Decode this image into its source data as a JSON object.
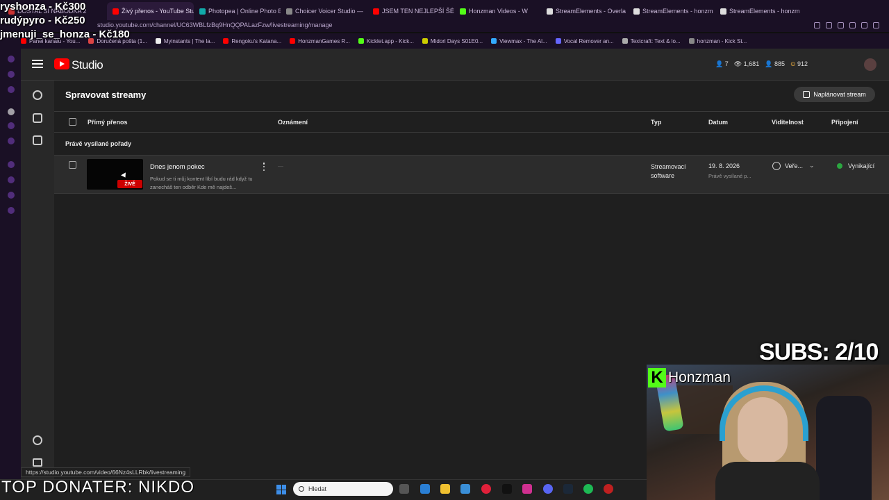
{
  "browser": {
    "tabs": [
      {
        "label": "DOSTAL SI NÁBODKA 2",
        "color": "#c33"
      },
      {
        "label": "Živý přenos - YouTube Stu",
        "color": "#f00",
        "active": true
      },
      {
        "label": "Photopea | Online Photo E",
        "color": "#1aa"
      },
      {
        "label": "Choicer Voicer Studio —",
        "color": "#888"
      },
      {
        "label": "JSEM TEN NEJLEPŠÍ ŠÉF",
        "color": "#f00"
      },
      {
        "label": "Honzman Videos - W",
        "color": "#53fc18"
      },
      {
        "label": "StreamElements - Overla",
        "color": "#ddd"
      },
      {
        "label": "StreamElements - honzm",
        "color": "#ddd"
      },
      {
        "label": "StreamElements - honzm",
        "color": "#ddd"
      }
    ],
    "url": "studio.youtube.com/channel/UC63WBLfzBq9HnQQPALazFzw/livestreaming/manage",
    "bookmarks": [
      {
        "label": "Panel kanálu - You...",
        "color": "#f00"
      },
      {
        "label": "Doručená pošta (1...",
        "color": "#d44"
      },
      {
        "label": "Myinstants | The la...",
        "color": "#eee"
      },
      {
        "label": "Rengoku's Katana...",
        "color": "#f00"
      },
      {
        "label": "HonzmanGames R...",
        "color": "#f00"
      },
      {
        "label": "Kicklet.app - Kick...",
        "color": "#53fc18"
      },
      {
        "label": "Midori Days S01E0...",
        "color": "#cc0"
      },
      {
        "label": "Viewmax - The Al...",
        "color": "#3af"
      },
      {
        "label": "Vocal Remover an...",
        "color": "#66f"
      },
      {
        "label": "Textcraft: Text & lo...",
        "color": "#aaa"
      },
      {
        "label": "honzman - Kick St...",
        "color": "#888"
      }
    ]
  },
  "studio": {
    "logo_text": "Studio",
    "header_stats": {
      "a": "7",
      "b": "1,681",
      "c": "885",
      "d": "912"
    },
    "page_title": "Spravovat streamy",
    "schedule_button": "Naplánovat stream",
    "columns": {
      "live": "Přímý přenos",
      "announcement": "Oznámení",
      "type": "Typ",
      "date": "Datum",
      "visibility": "Viditelnost",
      "connection": "Připojení"
    },
    "section_label": "Právě vysílané pořady",
    "row": {
      "title": "Dnes jenom pokec",
      "description": "Pokud se ti můj kontent líbí budu rád když tu zanecháš ten odběr Kde mě najdeš...",
      "live_badge": "ŽIVĚ",
      "announcement": "—",
      "type": "Streamovací software",
      "date": "19. 8. 2026",
      "date_sub": "Právě vysílané p...",
      "visibility": "Veře...",
      "connection": "Vynikající"
    },
    "status_url": "https://studio.youtube.com/video/66Nz4sLLRbk/livestreaming"
  },
  "taskbar": {
    "search_placeholder": "Hledat"
  },
  "overlay": {
    "donations": [
      "ryshonza - Kč300",
      "rudýpyro - Kč250",
      "jmenuji_se_honza - Kč180"
    ],
    "top_donater": "TOP DONATER: NIKDO",
    "subs": "SUBS: 2/10",
    "cam_name": "Honzman",
    "kick_letter": "K"
  },
  "colors": {
    "yt_red": "#ff0000",
    "live_green": "#2ba640",
    "kick_green": "#53fc18"
  }
}
